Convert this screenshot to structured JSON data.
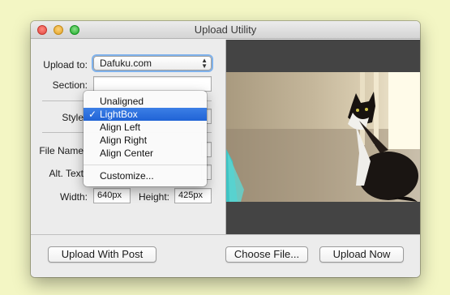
{
  "window": {
    "title": "Upload Utility"
  },
  "form": {
    "upload_to_label": "Upload to:",
    "upload_to_value": "Dafuku.com",
    "section_label": "Section:",
    "section_value": "",
    "style_label": "Style",
    "file_name_label": "File Name",
    "alt_text_label": "Alt. Text",
    "width_label": "Width:",
    "width_value": "640px",
    "height_label": "Height:",
    "height_value": "425px"
  },
  "style_menu": {
    "items": [
      "Unaligned",
      "LightBox",
      "Align Left",
      "Align Right",
      "Align Center"
    ],
    "selected": "LightBox",
    "check_glyph": "✓",
    "extra_item": "Customize..."
  },
  "buttons": {
    "upload_with_post": "Upload With Post",
    "choose_file": "Choose File...",
    "upload_now": "Upload Now"
  },
  "colors": {
    "background": "#f3f6c4",
    "menu_highlight": "#2f72df",
    "preview_bg": "#444444"
  }
}
